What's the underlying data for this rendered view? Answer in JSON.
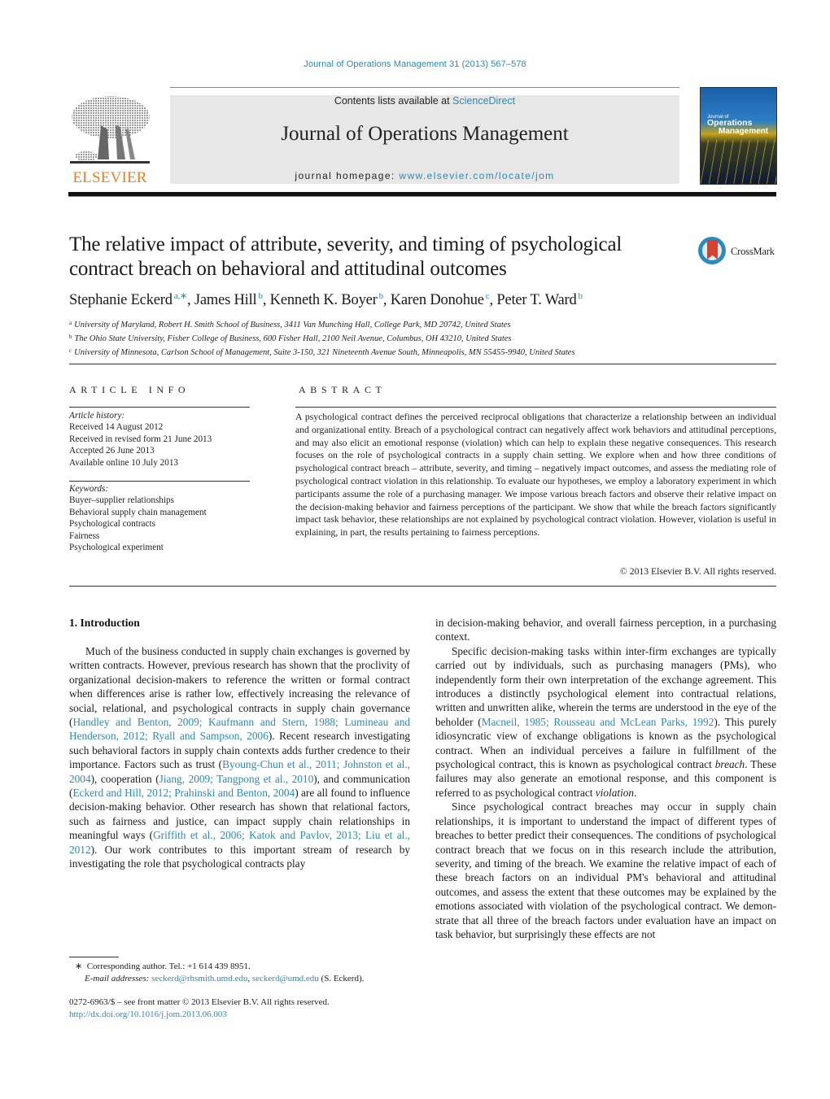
{
  "running_header": "Journal of Operations Management 31 (2013) 567–578",
  "masthead": {
    "publisher_logo": "ELSEVIER",
    "contents_prefix": "Contents lists available at ",
    "contents_link": "ScienceDirect",
    "journal_name": "Journal of Operations Management",
    "homepage_prefix": "journal homepage: ",
    "homepage_link": "www.elsevier.com/locate/jom",
    "cover": {
      "line1": "Journal of",
      "line2": "Operations",
      "line3": "Management"
    }
  },
  "title": "The relative impact of attribute, severity, and timing of psychological contract breach on behavioral and attitudinal outcomes",
  "crossmark_label": "CrossMark",
  "authors": [
    {
      "name": "Stephanie Eckerd",
      "sup": "a,∗",
      "sep": ", "
    },
    {
      "name": "James Hill",
      "sup": "b",
      "sep": ", "
    },
    {
      "name": "Kenneth K. Boyer",
      "sup": "b",
      "sep": ", "
    },
    {
      "name": "Karen Donohue",
      "sup": "c",
      "sep": ", "
    },
    {
      "name": "Peter T. Ward",
      "sup": "b",
      "sep": ""
    }
  ],
  "affiliations": [
    {
      "key": "a",
      "text": "University of Maryland, Robert H. Smith School of Business, 3411 Van Munching Hall, College Park, MD 20742, United States"
    },
    {
      "key": "b",
      "text": "The Ohio State University, Fisher College of Business, 600 Fisher Hall, 2100 Neil Avenue, Columbus, OH 43210, United States"
    },
    {
      "key": "c",
      "text": "University of Minnesota, Carlson School of Management, Suite 3-150, 321 Nineteenth Avenue South, Minneapolis, MN 55455-9940, United States"
    }
  ],
  "article_info": {
    "heading": "ARTICLE INFO",
    "history_label": "Article history:",
    "history": [
      "Received 14 August 2012",
      "Received in revised form 21 June 2013",
      "Accepted 26 June 2013",
      "Available online 10 July 2013"
    ],
    "keywords_label": "Keywords:",
    "keywords": [
      "Buyer–supplier relationships",
      "Behavioral supply chain management",
      "Psychological contracts",
      "Fairness",
      "Psychological experiment"
    ]
  },
  "abstract": {
    "heading": "ABSTRACT",
    "text": "A psychological contract defines the perceived reciprocal obligations that characterize a relationship between an individual and organizational entity. Breach of a psychological contract can negatively affect work behaviors and attitudinal perceptions, and may also elicit an emotional response (violation) which can help to explain these negative consequences. This research focuses on the role of psychological contracts in a supply chain setting. We explore when and how three conditions of psychological contract breach – attribute, severity, and timing – negatively impact outcomes, and assess the mediating role of psychological contract violation in this relationship. To evaluate our hypotheses, we employ a laboratory experiment in which participants assume the role of a purchasing manager. We impose various breach factors and observe their relative impact on the decision-making behavior and fairness perceptions of the participant. We show that while the breach factors significantly impact task behavior, these relationships are not explained by psychological contract violation. However, violation is useful in explaining, in part, the results pertaining to fairness perceptions.",
    "copyright": "© 2013 Elsevier B.V. All rights reserved."
  },
  "body": {
    "section_heading": "1.  Introduction",
    "left_paragraph": [
      {
        "t": "Much of the business conducted in supply chain exchanges is governed by written contracts. However, previous research has shown that the proclivity of organizational decision-makers to reference the written or formal contract when differences arise is rather low, effectively increasing the relevance of social, rela­tional, and psychological contracts in supply chain governance ("
      },
      {
        "link": "Handley and Benton, 2009; Kaufmann and Stern, 1988; Lumineau and Henderson, 2012; Ryall and Sampson, 2006"
      },
      {
        "t": "). Recent research investigating such behavioral factors in supply chain contexts adds further credence to their importance. Factors such as trust ("
      },
      {
        "link": "Byoung-Chun et al., 2011; Johnston et al., 2004"
      },
      {
        "t": "), cooperation ("
      },
      {
        "link": "Jiang, 2009; Tangpong et al., 2010"
      },
      {
        "t": "), and communication ("
      },
      {
        "link": "Eckerd and Hill, 2012; Prahinski and Benton, 2004"
      },
      {
        "t": ") are all found to influence decision-making behavior. Other research has shown that relational factors, such as fairness and justice, can impact supply chain relationships in meaningful ways ("
      },
      {
        "link": "Griffith et al., 2006; Katok and Pavlov, 2013; Liu et al., 2012"
      },
      {
        "t": "). Our work contributes to this important stream of research by investigating the role that psychological contracts play"
      }
    ],
    "right_paragraphs": [
      {
        "noindent": true,
        "parts": [
          {
            "t": "in decision-making behavior, and overall fairness perception, in a purchasing context."
          }
        ]
      },
      {
        "noindent": false,
        "parts": [
          {
            "t": "Specific decision-making tasks within inter-firm exchanges are typically carried out by individuals, such as purchasing managers (PMs), who independently form their own interpretation of the exchange agreement. This introduces a distinctly psychological element into contractual relations, written and unwritten alike, wherein the terms are understood in the eye of the beholder ("
          },
          {
            "link": "Macneil, 1985; Rousseau and McLean Parks, 1992"
          },
          {
            "t": "). This purely idiosyncratic view of exchange obligations is known as the psy­chological contract. When an individual perceives a failure in fulfillment of the psychological contract, this is known as psy­chological contract "
          },
          {
            "em": "breach"
          },
          {
            "t": ". These failures may also generate an emotional response, and this component is referred to as psycho­logical contract "
          },
          {
            "em": "violation"
          },
          {
            "t": "."
          }
        ]
      },
      {
        "noindent": false,
        "parts": [
          {
            "t": "Since psychological contract breaches may occur in supply chain relationships, it is important to understand the impact of different types of breaches to better predict their consequences. The con­ditions of psychological contract breach that we focus on in this research include the attribution, severity, and timing of the breach. We examine the relative impact of each of these breach factors on an individual PM's behavioral and attitudinal outcomes, and assess the extent that these outcomes may be explained by the emotions associated with violation of the psychological contract. We demon­strate that all three of the breach factors under evaluation have an impact on task behavior, but surprisingly these effects are not"
          }
        ]
      }
    ]
  },
  "footnote": {
    "marker": "∗",
    "corresponding": "Corresponding author. Tel.: +1 614 439 8951.",
    "email_label": "E-mail addresses:",
    "email1": "seckerd@rhsmith.umd.edu",
    "email_sep": ", ",
    "email2": "seckerd@umd.edu",
    "email_suffix": " (S. Eckerd)."
  },
  "front_matter": {
    "issn_line": "0272-6963/$ – see front matter © 2013 Elsevier B.V. All rights reserved.",
    "doi": "http://dx.doi.org/10.1016/j.jom.2013.06.003"
  },
  "colors": {
    "link": "#2a8ab8",
    "elsevier_orange": "#f07f1c",
    "masthead_gray": "#e7e7e7",
    "crossmark_blue": "#2b8bc1",
    "crossmark_red": "#d8402f"
  }
}
